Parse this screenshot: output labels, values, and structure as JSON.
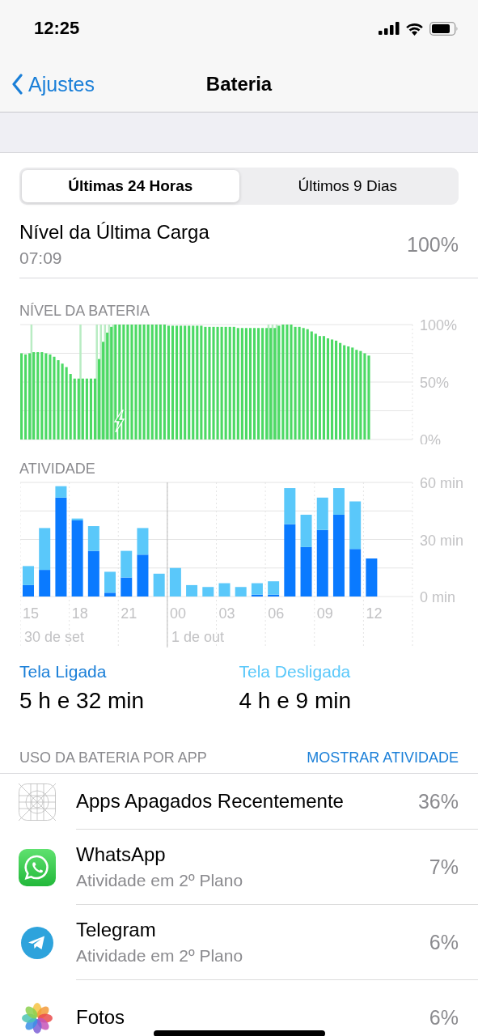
{
  "status_bar": {
    "time": "12:25"
  },
  "nav": {
    "back": "Ajustes",
    "title": "Bateria"
  },
  "tabs": [
    {
      "label": "Últimas 24 Horas",
      "selected": true
    },
    {
      "label": "Últimos 9 Dias",
      "selected": false
    }
  ],
  "last_charge": {
    "label": "Nível da Última Carga",
    "time": "07:09",
    "value": "100%"
  },
  "battery_level": {
    "title": "NÍVEL DA BATERIA",
    "chart_data": {
      "type": "bar",
      "ylim": [
        0,
        100
      ],
      "yticks": [
        {
          "value": 0,
          "label": "0%"
        },
        {
          "value": 50,
          "label": "50%"
        },
        {
          "value": 100,
          "label": "100%"
        }
      ],
      "series": [
        {
          "color": "#4cd964",
          "values": [
            75,
            74,
            75,
            76,
            76,
            76,
            75,
            74,
            72,
            69,
            66,
            63,
            57,
            53,
            53,
            53,
            53,
            53,
            53,
            70,
            85,
            93,
            98,
            100,
            100,
            100,
            100,
            100,
            100,
            100,
            100,
            100,
            100,
            100,
            100,
            100,
            99,
            99,
            99,
            99,
            99,
            99,
            99,
            99,
            99,
            98,
            98,
            98,
            98,
            98,
            98,
            98,
            98,
            97,
            97,
            97,
            97,
            97,
            97,
            97,
            97,
            97,
            97,
            99,
            100,
            100,
            100,
            98,
            98,
            97,
            96,
            94,
            92,
            90,
            90,
            88,
            87,
            86,
            84,
            82,
            81,
            80,
            78,
            77,
            75,
            73,
            null,
            null,
            null,
            null,
            null,
            null,
            null,
            null,
            null,
            null
          ]
        },
        {
          "color": "#b9ecc3",
          "values": [
            null,
            null,
            100,
            null,
            null,
            null,
            null,
            null,
            null,
            null,
            null,
            null,
            null,
            null,
            100,
            null,
            null,
            null,
            100,
            100,
            100,
            100,
            100,
            null,
            null,
            null,
            null,
            null,
            null,
            null,
            null,
            null,
            null,
            null,
            null,
            null,
            null,
            null,
            null,
            null,
            null,
            null,
            null,
            null,
            null,
            null,
            null,
            null,
            null,
            null,
            null,
            null,
            null,
            null,
            null,
            null,
            null,
            null,
            null,
            null,
            100,
            100,
            100,
            null,
            null,
            null,
            null,
            null,
            null,
            null,
            null,
            null,
            null,
            null,
            null,
            null,
            null,
            null,
            null,
            null,
            null,
            null,
            null,
            null,
            null,
            null,
            null,
            null,
            null,
            null,
            null,
            null,
            null,
            null,
            null,
            null
          ]
        }
      ]
    }
  },
  "activity": {
    "title": "ATIVIDADE",
    "chart_data": {
      "type": "bar",
      "stacked": true,
      "categories": [
        "15",
        null,
        null,
        "18",
        null,
        null,
        "21",
        null,
        null,
        "00",
        null,
        null,
        "03",
        null,
        null,
        "06",
        null,
        null,
        "09",
        null,
        null,
        "12",
        null,
        null
      ],
      "ylim": [
        0,
        60
      ],
      "yticks": [
        {
          "value": 0,
          "label": "0 min"
        },
        {
          "value": 30,
          "label": "30 min"
        },
        {
          "value": 60,
          "label": "60 min"
        }
      ],
      "series": [
        {
          "color": "#0a7aff",
          "values": [
            6,
            14,
            52,
            40,
            24,
            2,
            10,
            22,
            0,
            0,
            0,
            0,
            0,
            0,
            1,
            1,
            38,
            26,
            35,
            43,
            25,
            20,
            null,
            null
          ]
        },
        {
          "color": "#5ac8fa",
          "values": [
            10,
            22,
            6,
            1,
            13,
            11,
            14,
            14,
            12,
            15,
            6,
            5,
            7,
            5,
            6,
            7,
            19,
            17,
            17,
            14,
            25,
            0,
            null,
            null
          ]
        }
      ],
      "annotations": [
        "30 de set",
        "1 de out"
      ]
    }
  },
  "summary": [
    {
      "label": "Tela Ligada",
      "value": "5 h e 32 min",
      "color": "#1a7fd8"
    },
    {
      "label": "Tela Desligada",
      "value": "4 h e 9 min",
      "color": "#5ac8fa"
    }
  ],
  "usage": {
    "title": "USO DA BATERIA POR APP",
    "action": "MOSTRAR ATIVIDADE",
    "apps": [
      {
        "kind": "deleted",
        "name": "Apps Apagados Recentemente",
        "percent": "36%"
      },
      {
        "kind": "whatsapp",
        "name": "WhatsApp",
        "detail": "Atividade em 2º Plano",
        "percent": "7%"
      },
      {
        "kind": "telegram",
        "name": "Telegram",
        "detail": "Atividade em 2º Plano",
        "percent": "6%"
      },
      {
        "kind": "photos",
        "name": "Fotos",
        "percent": "6%"
      }
    ]
  }
}
